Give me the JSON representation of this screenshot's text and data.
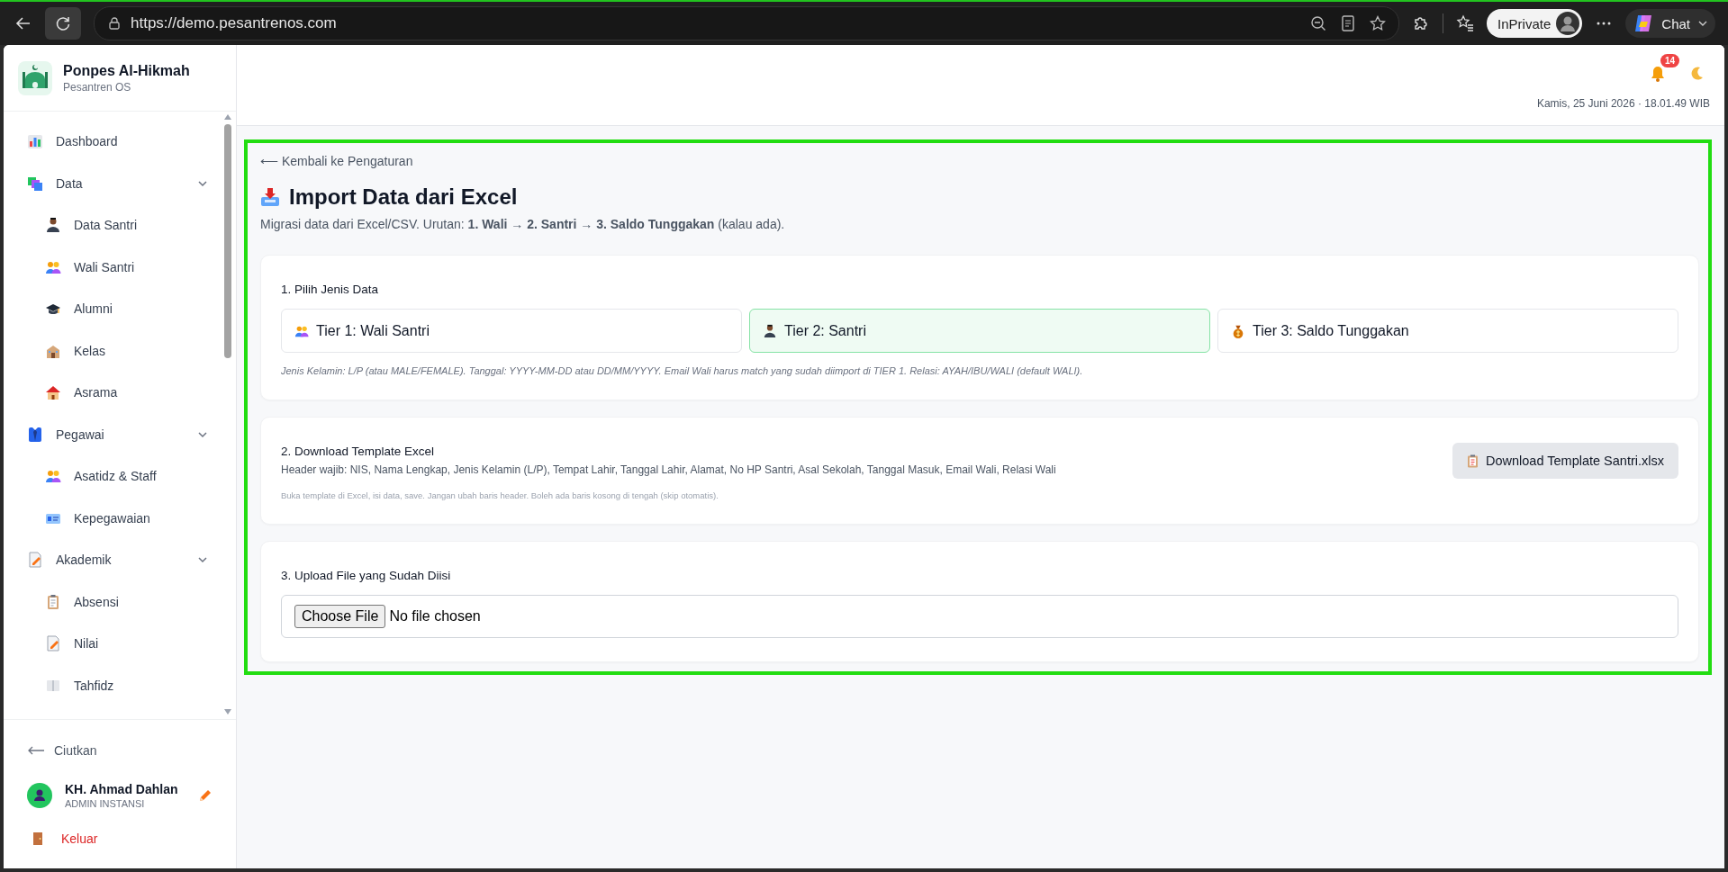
{
  "browser": {
    "url": "https://demo.pesantrenos.com",
    "profile_label": "InPrivate",
    "chat_label": "Chat"
  },
  "sidebar": {
    "brand": {
      "name": "Ponpes Al-Hikmah",
      "subtitle": "Pesantren OS"
    },
    "items": [
      {
        "label": "Dashboard",
        "kind": "link"
      },
      {
        "label": "Data",
        "kind": "group",
        "expanded": true,
        "children": [
          {
            "label": "Data Santri"
          },
          {
            "label": "Wali Santri"
          },
          {
            "label": "Alumni"
          },
          {
            "label": "Kelas"
          },
          {
            "label": "Asrama"
          }
        ]
      },
      {
        "label": "Pegawai",
        "kind": "group",
        "expanded": true,
        "children": [
          {
            "label": "Asatidz & Staff"
          },
          {
            "label": "Kepegawaian"
          }
        ]
      },
      {
        "label": "Akademik",
        "kind": "group",
        "expanded": true,
        "children": [
          {
            "label": "Absensi"
          },
          {
            "label": "Nilai"
          },
          {
            "label": "Tahfidz"
          }
        ]
      }
    ],
    "collapse_label": "Ciutkan",
    "user": {
      "name": "KH. Ahmad Dahlan",
      "role": "ADMIN INSTANSI"
    },
    "logout_label": "Keluar"
  },
  "header": {
    "notification_count": "14",
    "datetime": "Kamis, 25 Juni 2026 · 18.01.49 WIB"
  },
  "page": {
    "back_link": "⟵ Kembali ke Pengaturan",
    "title": "Import Data dari Excel",
    "subtitle": "Migrasi data dari Excel/CSV. Urutan: **1. Wali → 2. Santri → 3. Saldo Tunggakan** (kalau ada).",
    "steps": [
      {
        "kind": "choice",
        "title": "1. Pilih Jenis Data",
        "options": [
          {
            "label": "Tier 1: Wali Santri",
            "selected": false
          },
          {
            "label": "Tier 2: Santri",
            "selected": true
          },
          {
            "label": "Tier 3: Saldo Tunggakan",
            "selected": false
          }
        ],
        "hint": "Jenis Kelamin: L/P (atau MALE/FEMALE). Tanggal: YYYY-MM-DD atau DD/MM/YYYY. Email Wali harus match yang sudah diimport di TIER 1. Relasi: AYAH/IBU/WALI (default WALI)."
      },
      {
        "kind": "download",
        "title": "2. Download Template Excel",
        "description": "Header wajib: NIS, Nama Lengkap, Jenis Kelamin (L/P), Tempat Lahir, Tanggal Lahir, Alamat, No HP Santri, Asal Sekolah, Tanggal Masuk, Email Wali, Relasi Wali",
        "note": "Buka template di Excel, isi data, save. Jangan ubah baris header. Boleh ada baris kosong di tengah (skip otomatis).",
        "button": "Download Template Santri.xlsx"
      },
      {
        "kind": "upload",
        "title": "3. Upload File yang Sudah Diisi",
        "file_button": "Choose File",
        "file_status": "No file chosen"
      }
    ]
  }
}
